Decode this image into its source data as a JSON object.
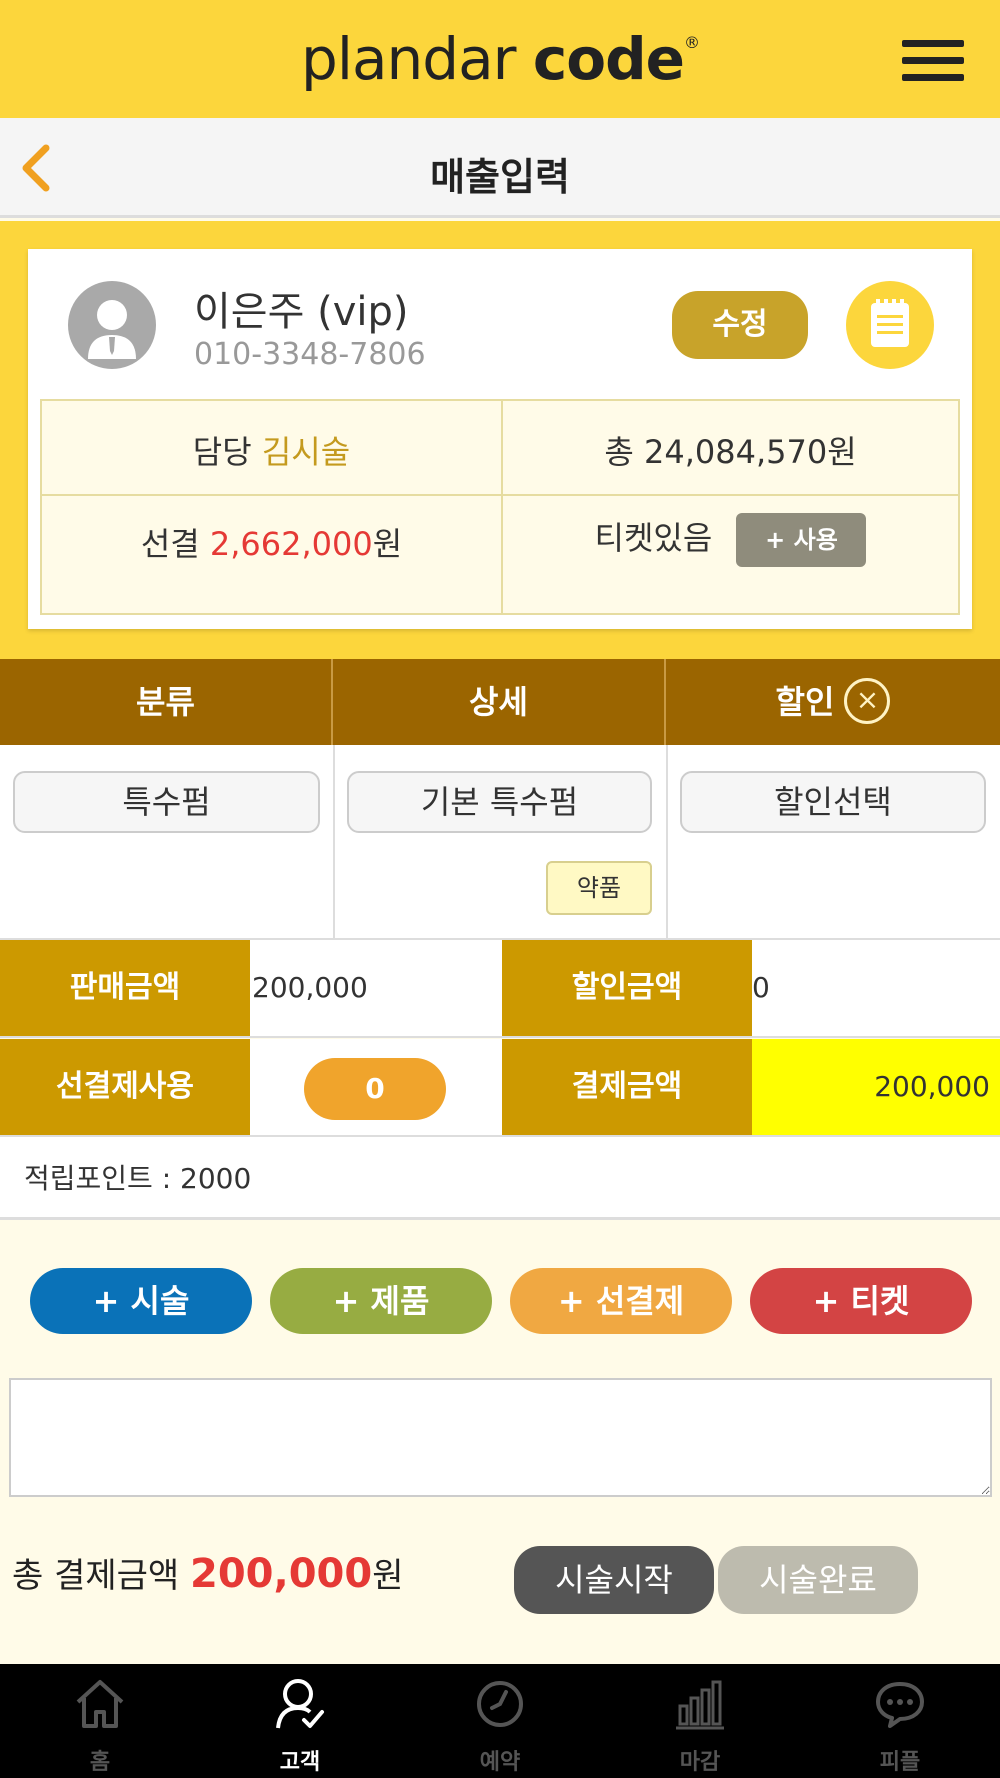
{
  "header": {
    "logo_thin": "plandar ",
    "logo_bold": "code",
    "logo_mark": "®"
  },
  "titlebar": {
    "title": "매출입력"
  },
  "customer": {
    "name": "이은주 (vip)",
    "phone": "010-3348-7806",
    "edit_label": "수정",
    "staff_label": "담당",
    "staff_name": "김시술",
    "total_label": "총 24,084,570원",
    "prepaid_label": "선결",
    "prepaid_amount": "2,662,000",
    "won": "원",
    "ticket_label": "티켓있음",
    "ticket_use_label": "+ 사용"
  },
  "category": {
    "headers": [
      "분류",
      "상세",
      "할인"
    ],
    "type_value": "특수펌",
    "detail_value": "기본 특수펌",
    "medicine_tag": "약품",
    "discount_value": "할인선택"
  },
  "amounts": {
    "sale_label": "판매금액",
    "sale_value": "200,000",
    "discount_label": "할인금액",
    "discount_value": "0",
    "prepay_label": "선결제사용",
    "prepay_value": "0",
    "payment_label": "결제금액",
    "payment_value": "200,000"
  },
  "points": {
    "text": "적립포인트 : 2000"
  },
  "add_buttons": [
    {
      "label": "+ 시술",
      "color": "#0a72b8"
    },
    {
      "label": "+ 제품",
      "color": "#97ac42"
    },
    {
      "label": "+ 선결제",
      "color": "#f0a842"
    },
    {
      "label": "+ 티켓",
      "color": "#d34444"
    }
  ],
  "footer": {
    "total_label": "총 결제금액 ",
    "total_amount": "200,000",
    "total_unit": "원",
    "start_label": "시술시작",
    "complete_label": "시술완료"
  },
  "nav": {
    "items": [
      {
        "label": "홈",
        "icon": "home-icon"
      },
      {
        "label": "고객",
        "icon": "customer-icon"
      },
      {
        "label": "예약",
        "icon": "clock-icon"
      },
      {
        "label": "마감",
        "icon": "bar-chart-icon"
      },
      {
        "label": "피플",
        "icon": "chat-icon"
      }
    ],
    "active": "고객"
  }
}
